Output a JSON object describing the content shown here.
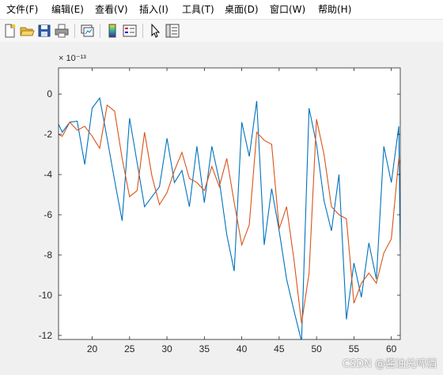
{
  "menubar": {
    "items": [
      {
        "label": "文件(F)",
        "name": "menu-file"
      },
      {
        "label": "编辑(E)",
        "name": "menu-edit"
      },
      {
        "label": "查看(V)",
        "name": "menu-view"
      },
      {
        "label": "插入(I)",
        "name": "menu-insert"
      },
      {
        "label": "工具(T)",
        "name": "menu-tools"
      },
      {
        "label": "桌面(D)",
        "name": "menu-desktop"
      },
      {
        "label": "窗口(W)",
        "name": "menu-window"
      },
      {
        "label": "帮助(H)",
        "name": "menu-help"
      }
    ]
  },
  "toolbar": {
    "buttons": [
      "new-figure-icon",
      "open-folder-icon",
      "save-disk-icon",
      "print-icon",
      "link-plot-icon",
      "colorbar-icon",
      "legend-icon",
      "pointer-arrow-icon",
      "property-editor-icon"
    ]
  },
  "watermark": "CSDN @酱油兑啤酒",
  "chart_data": {
    "type": "line",
    "title": "",
    "xlabel": "",
    "ylabel": "",
    "y_exponent_label": "× 10⁻¹³",
    "xlim": [
      15.5,
      61.2
    ],
    "ylim": [
      -12.2,
      1.3
    ],
    "xticks": [
      20,
      25,
      30,
      35,
      40,
      45,
      50,
      55,
      60
    ],
    "yticks": [
      0,
      -2,
      -4,
      -6,
      -8,
      -10,
      -12
    ],
    "grid": false,
    "series": [
      {
        "color": "#0072BD",
        "x": [
          15.5,
          16,
          17,
          18,
          19,
          20,
          21,
          22,
          23,
          24,
          25,
          26,
          27,
          28,
          29,
          30,
          31,
          32,
          33,
          34,
          35,
          36,
          37,
          38,
          39,
          40,
          41,
          42,
          43,
          44,
          45,
          46,
          47,
          48,
          49,
          50,
          51,
          52,
          53,
          54,
          55,
          56,
          57,
          58,
          59,
          60,
          61,
          61.2
        ],
        "y": [
          -1.5,
          -1.9,
          -1.4,
          -1.35,
          -3.5,
          -0.7,
          -0.2,
          -2.2,
          -4.3,
          -6.3,
          -1.2,
          -3.4,
          -5.6,
          -5.1,
          -4.6,
          -2.2,
          -4.4,
          -3.8,
          -5.6,
          -2.6,
          -5.4,
          -2.6,
          -4.3,
          -7.0,
          -8.8,
          -1.4,
          -3.1,
          -0.35,
          -7.5,
          -4.7,
          -6.8,
          -9.2,
          -10.8,
          -12.3,
          -0.7,
          -2.5,
          -5.3,
          -6.8,
          -4.0,
          -11.2,
          -8.4,
          -10.1,
          -7.4,
          -9.2,
          -2.6,
          -4.4,
          -1.6,
          -7.8
        ]
      },
      {
        "color": "#D95319",
        "x": [
          15.5,
          16,
          17,
          18,
          19,
          20,
          21,
          22,
          23,
          24,
          25,
          26,
          27,
          28,
          29,
          30,
          31,
          32,
          33,
          34,
          35,
          36,
          37,
          38,
          39,
          40,
          41,
          42,
          43,
          44,
          45,
          46,
          47,
          48,
          49,
          50,
          51,
          52,
          53,
          54,
          55,
          56,
          57,
          58,
          59,
          60,
          61,
          61.2
        ],
        "y": [
          -2.0,
          -2.1,
          -1.4,
          -1.8,
          -1.6,
          -2.1,
          -2.7,
          -0.55,
          -0.85,
          -3.2,
          -5.1,
          -4.8,
          -1.9,
          -4.1,
          -5.5,
          -4.9,
          -3.8,
          -2.9,
          -4.2,
          -4.4,
          -4.8,
          -3.6,
          -4.6,
          -3.2,
          -5.4,
          -7.5,
          -6.5,
          -1.9,
          -2.3,
          -2.5,
          -6.7,
          -5.6,
          -8.3,
          -11.4,
          -8.9,
          -1.25,
          -3.0,
          -5.6,
          -6.0,
          -6.2,
          -10.4,
          -9.4,
          -8.9,
          -9.4,
          -7.9,
          -7.2,
          -3.2,
          -3.45
        ]
      }
    ]
  }
}
